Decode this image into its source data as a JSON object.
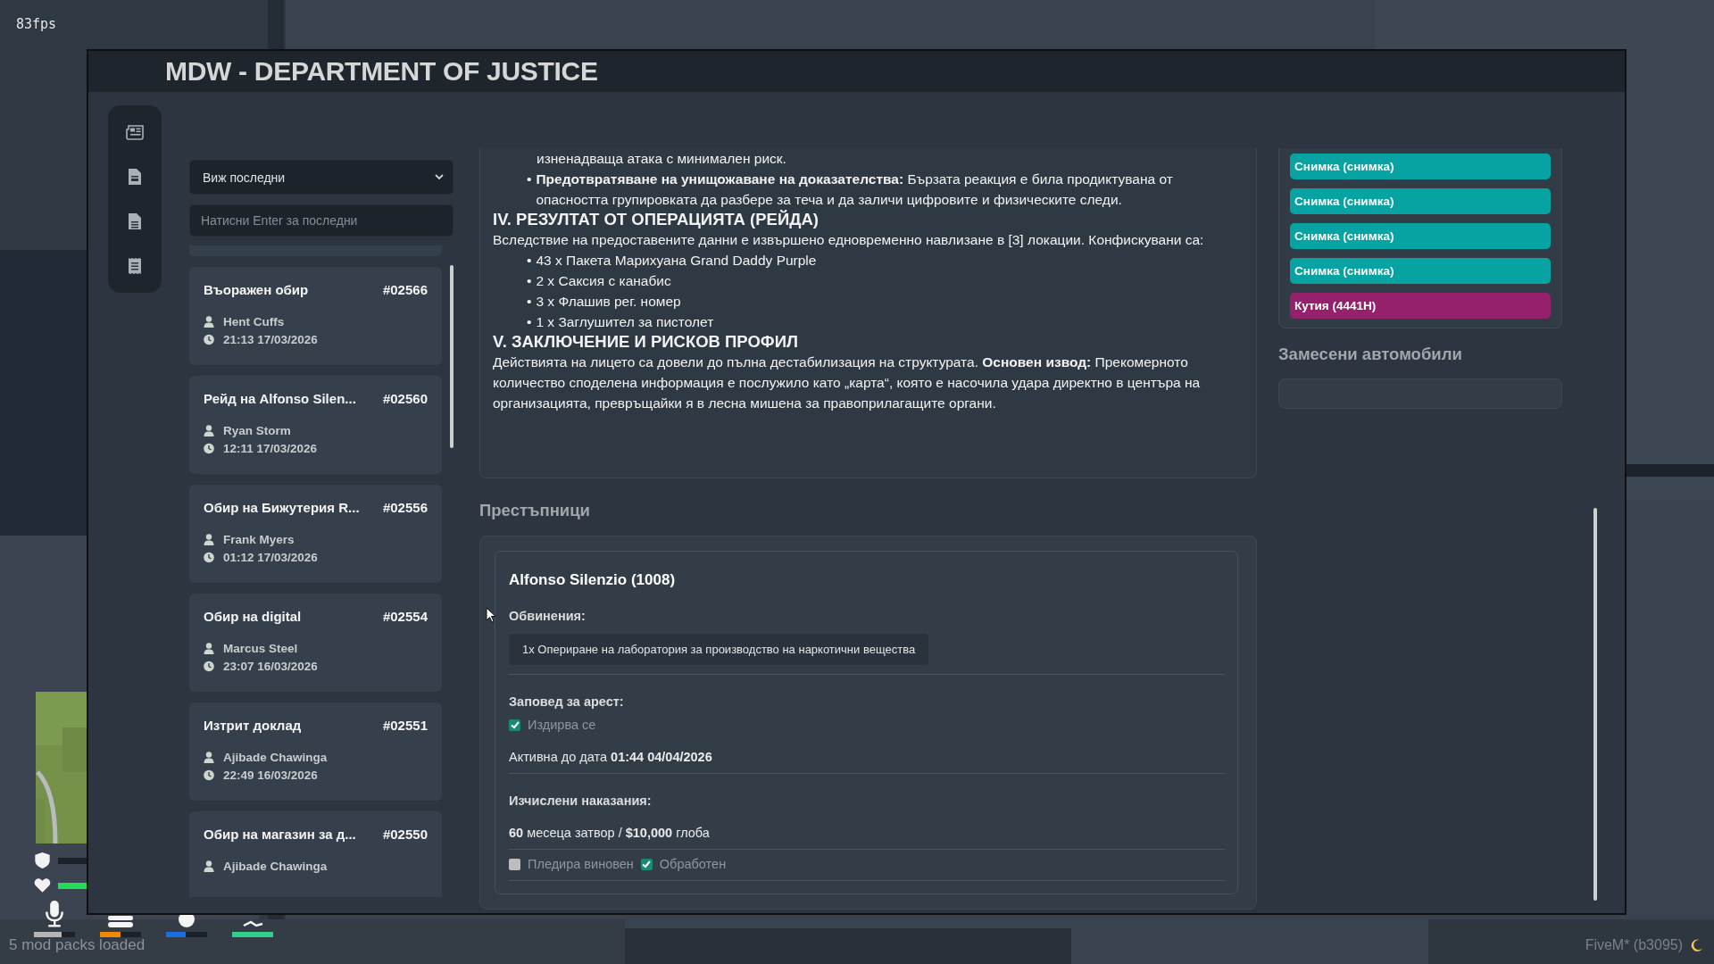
{
  "hud": {
    "fps": "83fps",
    "status_bars": [
      {
        "kind": "armor",
        "level": 0
      },
      {
        "kind": "health",
        "level": 1
      }
    ],
    "needs": [
      {
        "kind": "voice",
        "level": 0.67
      },
      {
        "kind": "hunger",
        "level": 0.5
      },
      {
        "kind": "thirst",
        "level": 0.48
      },
      {
        "kind": "stamina",
        "level": 1
      }
    ],
    "loaded_note": "5 mod packs loaded",
    "build": "FiveM* (b3095)"
  },
  "window": {
    "title": "MDW - DEPARTMENT OF JUSTICE"
  },
  "reports": {
    "filter": "Виж последни",
    "search": {
      "placeholder": "Натисни Enter за последни"
    },
    "items": [
      {
        "title": "Въоражен обир",
        "id": "#02566",
        "author": "Hent Cuffs",
        "time": "21:13 17/03/2026"
      },
      {
        "title": "Рейд на Alfonso Silen...",
        "id": "#02560",
        "author": "Ryan Storm",
        "time": "12:11 17/03/2026"
      },
      {
        "title": "Обир на Бижутерия R...",
        "id": "#02556",
        "author": "Frank Myers",
        "time": "01:12 17/03/2026"
      },
      {
        "title": "Обир на digital",
        "id": "#02554",
        "author": "Marcus Steel",
        "time": "23:07 16/03/2026"
      },
      {
        "title": "Изтрит доклад",
        "id": "#02551",
        "author": "Ajibade Chawinga",
        "time": "22:49 16/03/2026"
      },
      {
        "title": "Обир на магазин за д...",
        "id": "#02550",
        "author": "Ajibade Chawinga"
      }
    ]
  },
  "report_body": [
    {
      "kind": "continuation",
      "text": "изненадваща атака с минимален риск."
    },
    {
      "kind": "bullet",
      "marker": "•",
      "text": "**Предотвратяване на унищожаване на доказателства:** Бързата реакция е била продиктувана от опасността групировката да разбере за теча и да заличи цифровите и физическите следи."
    },
    {
      "kind": "heading",
      "text": "IV. РЕЗУЛТАТ ОТ ОПЕРАЦИЯТА (РЕЙДА)"
    },
    {
      "kind": "paragraph",
      "text": "Вследствие на предоставените данни е извършено едновременно навлизане в [3] локации. Конфискувани са:"
    },
    {
      "kind": "bullet",
      "marker": "•",
      "text": "43 x Пакета Марихуана Grand Daddy Purple"
    },
    {
      "kind": "bullet",
      "marker": "•",
      "text": "2 x Саксия с канабис"
    },
    {
      "kind": "bullet",
      "marker": "•",
      "text": "3 x Флашив рег. номер"
    },
    {
      "kind": "bullet",
      "marker": "•",
      "text": "1 x Заглушител за пистолет"
    },
    {
      "kind": "heading",
      "text": "V. ЗАКЛЮЧЕНИЕ И РИСКОВ ПРОФИЛ"
    },
    {
      "kind": "paragraph",
      "text": "Действията на лицето са довели до пълна дестабилизация на структурата. **Основен извод:** Прекомерното количество споделена информация е послужило като „карта“, която е насочила удара директно в центъра на организацията, превръщайки я в лесна мишена за правоприлагащите органи."
    }
  ],
  "offenders": {
    "heading": "Престъпници",
    "items": [
      {
        "name": "Alfonso Silenzio (1008)",
        "charges_label": "Обвинения:",
        "charges": [
          "1x Опериране на лаборатория за производство на наркотични вещества"
        ],
        "warrant_label": "Заповед за арест:",
        "wanted": {
          "label": "Издирва се",
          "checked": true
        },
        "active_until": "Активна до дата **01:44 04/04/2026**",
        "penalties_label": "Изчислени наказания:",
        "penalties": "**60** месеца затвор / **$10,000** глоба",
        "flags": [
          {
            "label": "Пледира виновен",
            "checked": false
          },
          {
            "label": "Обработен",
            "checked": true
          }
        ]
      }
    ]
  },
  "evidence": {
    "items": [
      {
        "label": "Снимка (снимка)",
        "color": "#07a3a3"
      },
      {
        "label": "Снимка (снимка)",
        "color": "#07a3a3"
      },
      {
        "label": "Снимка (снимка)",
        "color": "#07a3a3"
      },
      {
        "label": "Снимка (снимка)",
        "color": "#07a3a3"
      },
      {
        "label": "Кутия (4441H)",
        "color": "#95206b"
      }
    ]
  },
  "vehicles": {
    "heading": "Замесени автомобили"
  }
}
